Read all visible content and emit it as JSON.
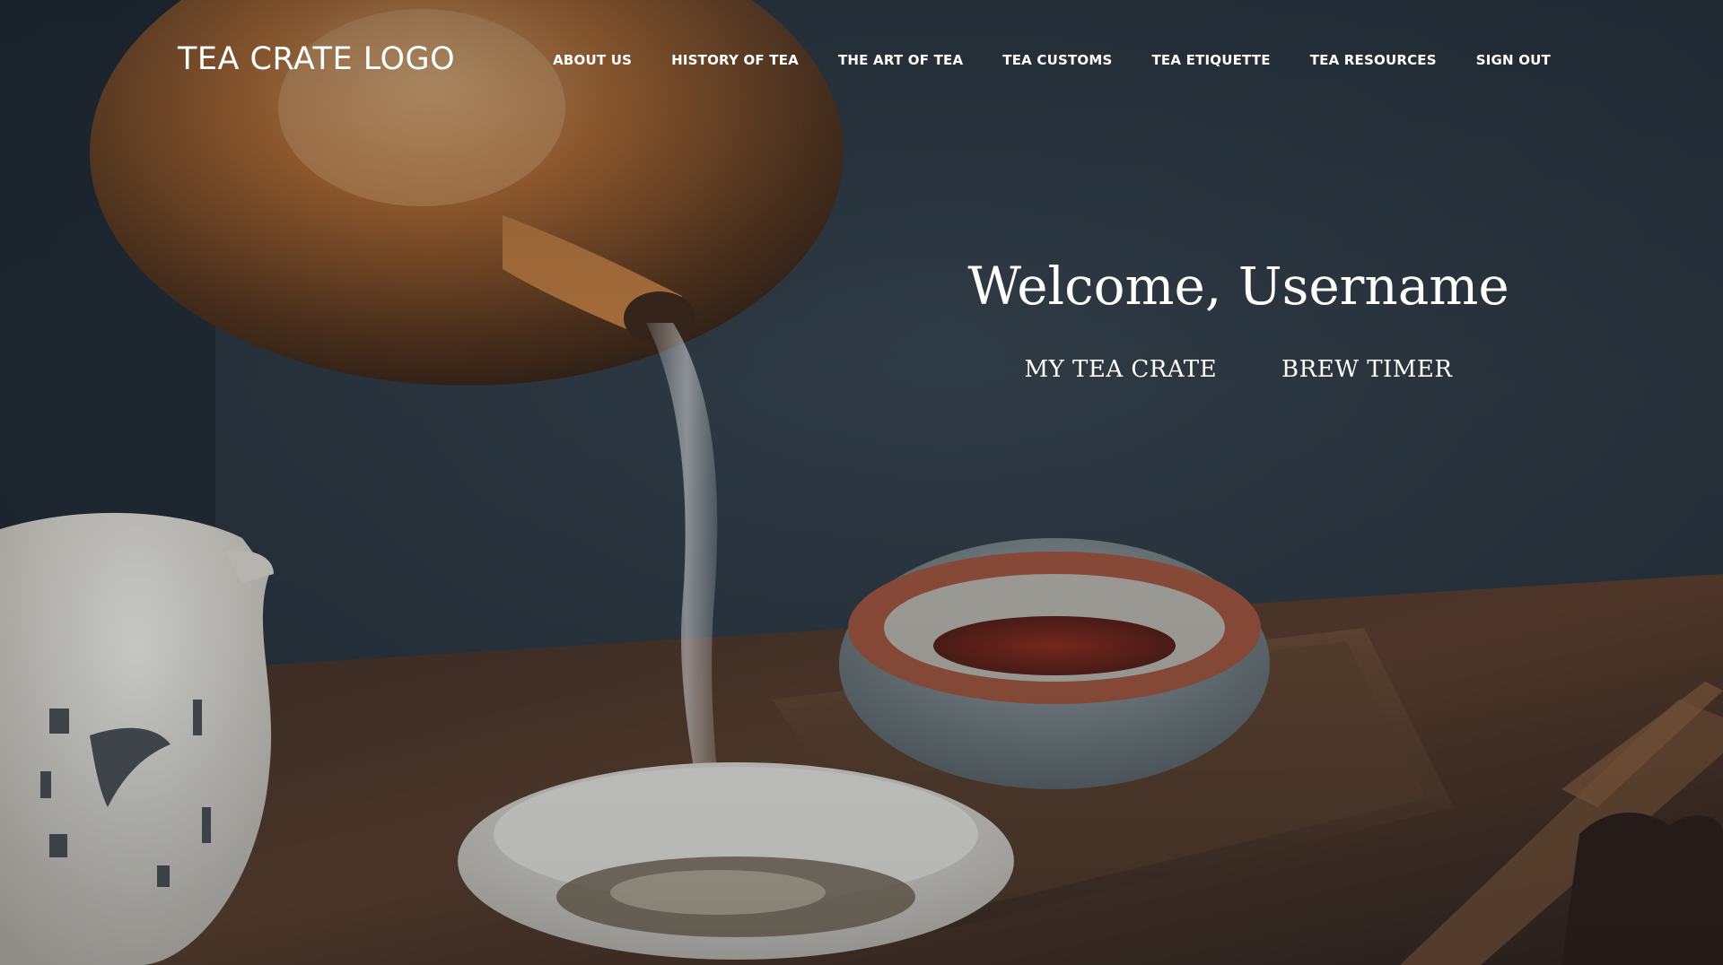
{
  "header": {
    "logo": "TEA CRATE LOGO",
    "nav": [
      {
        "label": "ABOUT US"
      },
      {
        "label": "HISTORY OF TEA"
      },
      {
        "label": "THE ART OF TEA"
      },
      {
        "label": "TEA CUSTOMS"
      },
      {
        "label": "TEA ETIQUETTE"
      },
      {
        "label": "TEA RESOURCES"
      },
      {
        "label": "SIGN OUT"
      }
    ]
  },
  "hero": {
    "welcome": "Welcome, Username",
    "actions": [
      {
        "label": "MY TEA CRATE"
      },
      {
        "label": "BREW TIMER"
      }
    ],
    "background": "photo of a copper kettle pouring tea into a white cup, teacups and a pitcher on a wooden tray"
  },
  "colors": {
    "text": "#ffffff",
    "background": "#1d2630"
  }
}
